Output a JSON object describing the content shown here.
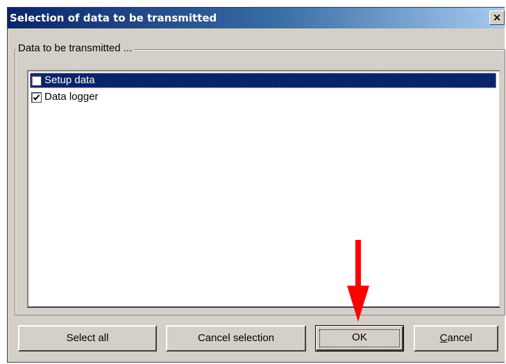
{
  "dialog": {
    "title": "Selection of data to be transmitted",
    "close_glyph": "×"
  },
  "group": {
    "label": "Data to be transmitted ..."
  },
  "list": {
    "items": [
      {
        "label": "Setup data",
        "checked": false,
        "selected": true
      },
      {
        "label": "Data logger",
        "checked": true,
        "selected": false
      }
    ]
  },
  "buttons": {
    "select_all": "Select all",
    "cancel_selection": "Cancel selection",
    "ok": "OK",
    "cancel": "Cancel"
  },
  "annotation": {
    "arrow_color": "#ff0000",
    "arrow_target": "ok-button"
  },
  "colors": {
    "titlebar_start": "#0a246a",
    "titlebar_end": "#a6caf0",
    "face": "#d4d0c8",
    "selection": "#0a246a"
  }
}
